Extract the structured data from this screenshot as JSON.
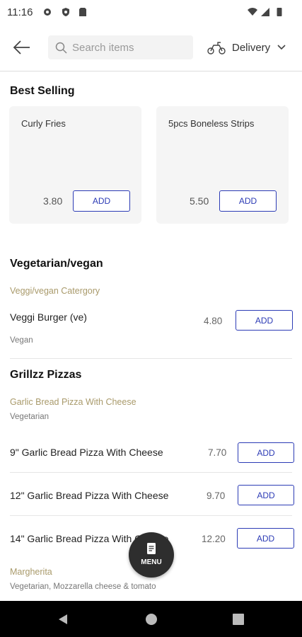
{
  "status_bar": {
    "time": "11:16"
  },
  "header": {
    "search_placeholder": "Search items",
    "delivery_label": "Delivery"
  },
  "best_selling": {
    "title": "Best Selling",
    "items": [
      {
        "name": "Curly Fries",
        "price": "3.80",
        "add_label": "ADD"
      },
      {
        "name": "5pcs Boneless Strips",
        "price": "5.50",
        "add_label": "ADD"
      }
    ]
  },
  "sections": [
    {
      "title": "Vegetarian/vegan",
      "category": "Veggi/vegan Catergory",
      "items": [
        {
          "name": "Veggi Burger (ve)",
          "price": "4.80",
          "desc": "Vegan",
          "add_label": "ADD"
        }
      ]
    },
    {
      "title": "Grillzz Pizzas",
      "category": "Garlic Bread Pizza With Cheese",
      "category_desc": "Vegetarian",
      "items": [
        {
          "name": "9\" Garlic Bread Pizza With Cheese",
          "price": "7.70",
          "add_label": "ADD"
        },
        {
          "name": "12\" Garlic Bread Pizza With Cheese",
          "price": "9.70",
          "add_label": "ADD"
        },
        {
          "name": "14\" Garlic Bread Pizza With Cheese",
          "price": "12.20",
          "add_label": "ADD"
        }
      ],
      "next_category": "Margherita",
      "next_category_desc": "Vegetarian, Mozzarella cheese & tomato"
    }
  ],
  "fab": {
    "label": "MENU"
  },
  "colors": {
    "accent": "#2c3bb5",
    "category": "#a99a6b"
  }
}
